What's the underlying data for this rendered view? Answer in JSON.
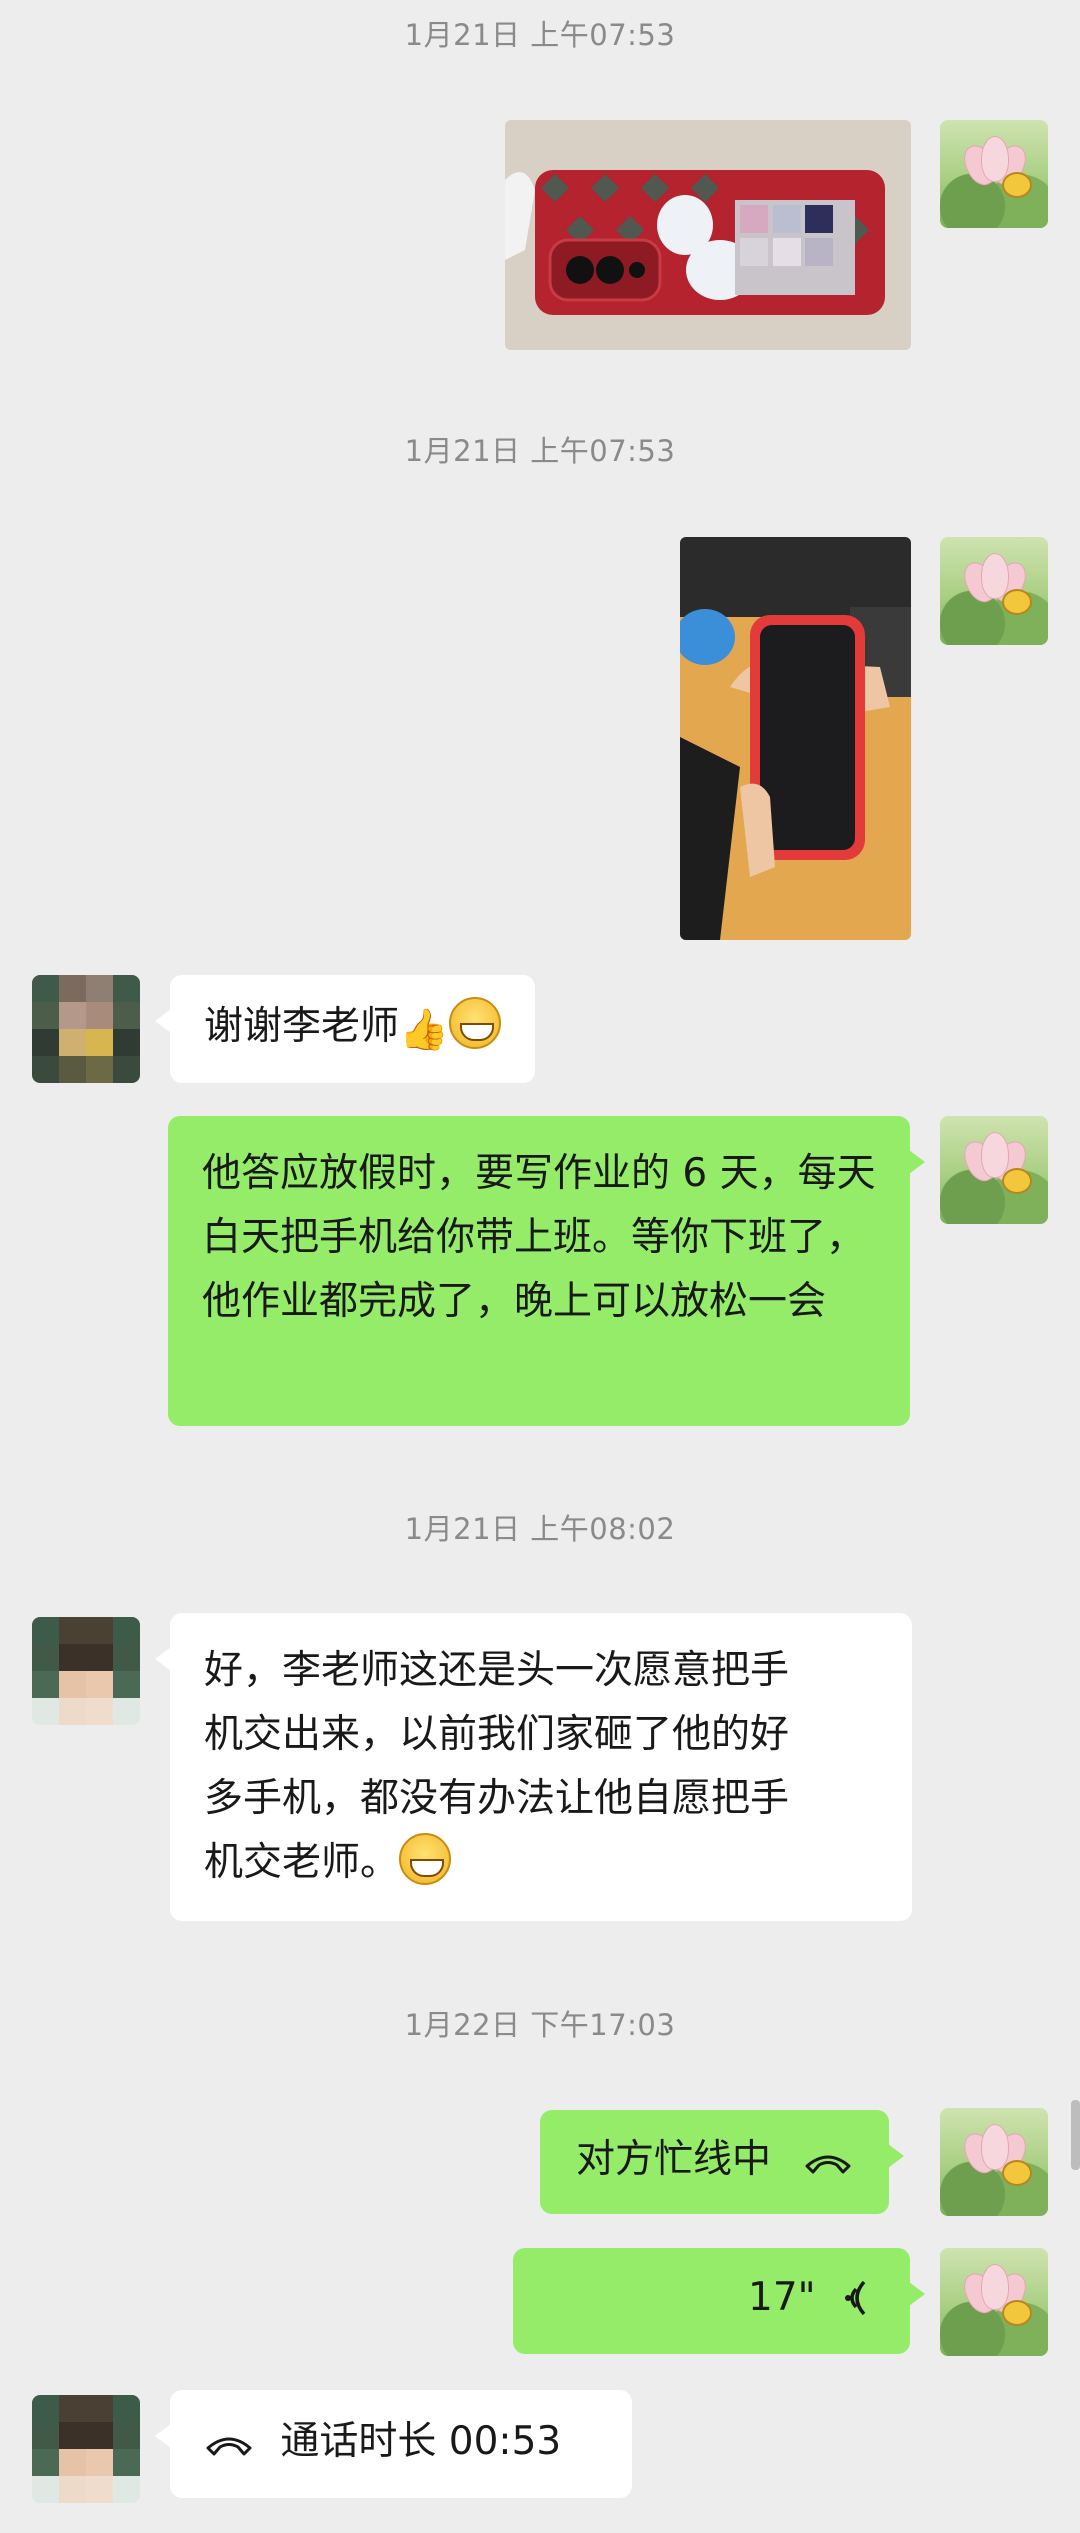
{
  "timestamps": [
    "1月21日 上午07:53",
    "1月21日 上午07:53",
    "1月21日 上午08:02",
    "1月22日 下午17:03"
  ],
  "messages": {
    "thanks": "谢谢李老师",
    "promise": "他答应放假时，要写作业的 6 天，每天白天把手机给你带上班。等你下班了，他作业都完成了，晚上可以放松一会",
    "reply_line1": "好，李老师这还是头一次愿意把手",
    "reply_line2": "机交出来，以前我们家砸了他的好",
    "reply_line3": "多手机，都没有办法让他自愿把手",
    "reply_line4": "机交老师。",
    "busy": "对方忙线中",
    "voice_duration": "17\"",
    "call_duration": "通话时长 00:53"
  },
  "icons": {
    "self_avatar": "lotus-avatar",
    "other_avatar": "pixelated-avatar",
    "emoji": "grin-emoji",
    "thumb": "thumbs-up-emoji",
    "phone": "phone-handset-icon",
    "voice": "voice-wave-icon"
  },
  "colors": {
    "background": "#ededed",
    "self_bubble": "#95ec69",
    "other_bubble": "#ffffff",
    "timestamp": "#8a8a8a"
  }
}
